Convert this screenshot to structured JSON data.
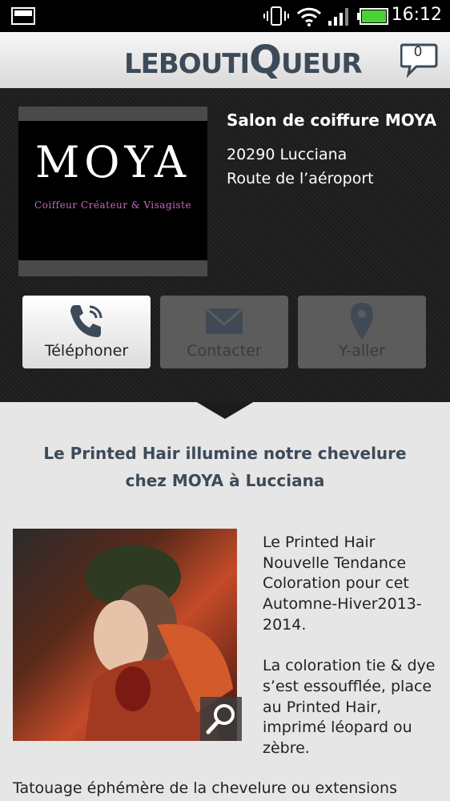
{
  "status_bar": {
    "time": "16:12",
    "icons": [
      "gallery-icon",
      "vibrate-icon",
      "wifi-icon",
      "signal-icon",
      "battery-icon"
    ],
    "battery_color": "#4cd137"
  },
  "app_bar": {
    "logo_text": "LEBOUTIQUEUR",
    "logo_parts": {
      "a": "LEBOUTI",
      "b": "Q",
      "c": "UEUR"
    },
    "message_count": "0"
  },
  "salon": {
    "logo_word": "MOYA",
    "logo_tagline": "Coiffeur Créateur & Visagiste",
    "name": "Salon de coiffure MOYA",
    "address_line1": "20290  Lucciana",
    "address_line2": "Route de l’aéroport"
  },
  "actions": {
    "call_label": "Téléphoner",
    "contact_label": "Contacter",
    "directions_label": "Y-aller"
  },
  "article": {
    "title": "Le Printed Hair illumine notre chevelure chez MOYA à Lucciana",
    "body": "Le Printed Hair Nouvelle Tendance Coloration pour cet Automne-Hiver2013-2014.\n\nLa coloration  tie & dye s’est essoufflée, place au Printed Hair, imprimé léopard ou zèbre.",
    "bottom_text": "Tatouage éphémère de la chevelure ou extensions"
  },
  "colors": {
    "accent_text": "#3d4a58",
    "dark_panel": "#1c1c1c",
    "tagline": "#c36bc3"
  }
}
